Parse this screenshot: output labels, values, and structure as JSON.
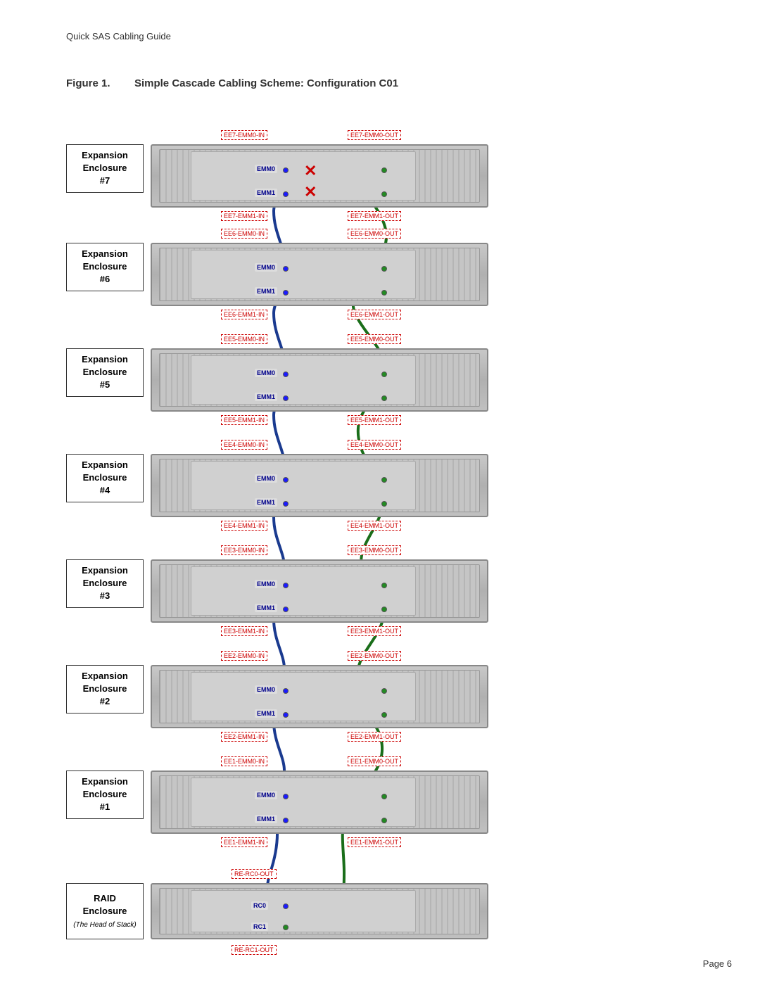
{
  "header": {
    "title": "Quick SAS Cabling Guide"
  },
  "figure": {
    "number": "Figure 1.",
    "title": "Simple Cascade Cabling Scheme: Configuration C01"
  },
  "page": {
    "number": "Page 6"
  },
  "enclosures": [
    {
      "id": "ee7",
      "label": "Expansion\nEnclosure\n#7",
      "italic": null,
      "ports": {
        "emm0_in": "EE7-EMM0-IN",
        "emm0_out": "EE7-EMM0-OUT",
        "emm1_in": "EE7-EMM1-IN",
        "emm1_out": "EE7-EMM1-OUT"
      },
      "has_x": true
    },
    {
      "id": "ee6",
      "label": "Expansion\nEnclosure\n#6",
      "italic": null,
      "ports": {
        "emm0_in": "EE6-EMM0-IN",
        "emm0_out": "EE6-EMM0-OUT",
        "emm1_in": "EE6-EMM1-IN",
        "emm1_out": "EE6-EMM1-OUT"
      },
      "has_x": false
    },
    {
      "id": "ee5",
      "label": "Expansion\nEnclosure\n#5",
      "italic": null,
      "ports": {
        "emm0_in": "EE5-EMM0-IN",
        "emm0_out": "EE5-EMM0-OUT",
        "emm1_in": "EE5-EMM1-IN",
        "emm1_out": "EE5-EMM1-OUT"
      },
      "has_x": false
    },
    {
      "id": "ee4",
      "label": "Expansion\nEnclosure\n#4",
      "italic": null,
      "ports": {
        "emm0_in": "EE4-EMM0-IN",
        "emm0_out": "EE4-EMM0-OUT",
        "emm1_in": "EE4-EMM1-IN",
        "emm1_out": "EE4-EMM1-OUT"
      },
      "has_x": false
    },
    {
      "id": "ee3",
      "label": "Expansion\nEnclosure\n#3",
      "italic": null,
      "ports": {
        "emm0_in": "EE3-EMM0-IN",
        "emm0_out": "EE3-EMM0-OUT",
        "emm1_in": "EE3-EMM1-IN",
        "emm1_out": "EE3-EMM1-OUT"
      },
      "has_x": false
    },
    {
      "id": "ee2",
      "label": "Expansion\nEnclosure\n#2",
      "italic": null,
      "ports": {
        "emm0_in": "EE2-EMM0-IN",
        "emm0_out": "EE2-EMM0-OUT",
        "emm1_in": "EE2-EMM1-IN",
        "emm1_out": "EE2-EMM1-OUT"
      },
      "has_x": false
    },
    {
      "id": "ee1",
      "label": "Expansion\nEnclosure\n#1",
      "italic": null,
      "ports": {
        "emm0_in": "EE1-EMM0-IN",
        "emm0_out": "EE1-EMM0-OUT",
        "emm1_in": "EE1-EMM1-IN",
        "emm1_out": "EE1-EMM1-OUT"
      },
      "has_x": false
    },
    {
      "id": "raid",
      "label": "RAID\nEnclosure",
      "italic": "(The Head of Stack)",
      "ports": {
        "emm0_in": null,
        "emm0_out": "RE-RC0-OUT",
        "emm1_in": null,
        "emm1_out": "RE-RC1-OUT"
      },
      "has_x": false
    }
  ],
  "colors": {
    "blue_cable": "#1a3a8f",
    "green_cable": "#1a6e1a",
    "red_label": "#cc0000",
    "x_color": "#cc0000"
  }
}
